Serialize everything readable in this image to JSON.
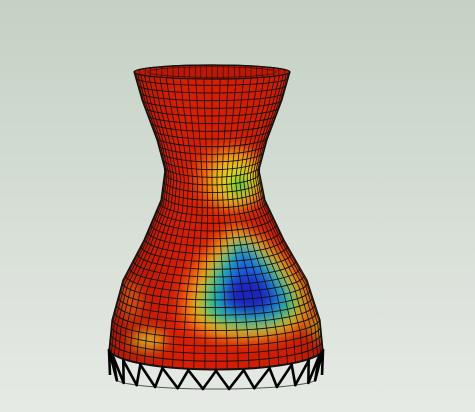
{
  "viewport": {
    "background_top": "#c5d1c5",
    "background_bottom": "#e6eae5",
    "content": "cooling-tower-fem-contour-plot"
  },
  "model": {
    "shape": "hyperboloid-cooling-tower-shell",
    "mesh": "quad-shell-mesh",
    "support": "v-shaped-column-ring",
    "columns": 12,
    "contour_colors": [
      "#d81e05",
      "#f05a0a",
      "#f2b41e",
      "#e0e81e",
      "#37c837",
      "#23b0ad",
      "#1e64e6",
      "#1c28c8"
    ],
    "mesh_line_color": "#111111",
    "column_color": "#000000"
  }
}
